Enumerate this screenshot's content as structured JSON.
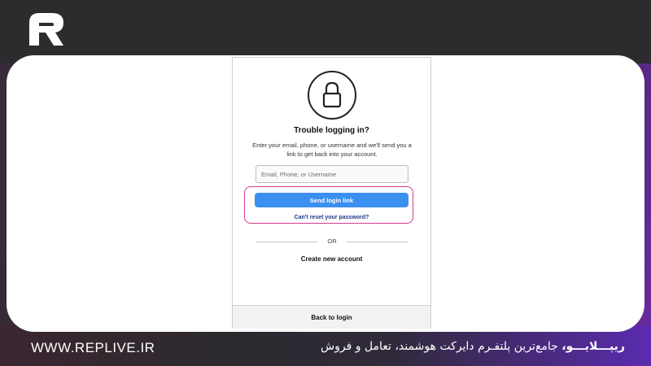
{
  "brand": {
    "logo_icon": "replive-logo-icon",
    "website": "WWW.REPLIVE.IR",
    "tagline_brand": "ریپـــلایـــو،",
    "tagline_rest": " جامع‌ترین پلتفـرم دایرکت هوشمند، تعامل و فروش"
  },
  "screen": {
    "icon": "lock-icon",
    "title": "Trouble logging in?",
    "description": "Enter your email, phone, or username and we'll send you a link to get back into your account.",
    "input_placeholder": "Email, Phone, or Username",
    "input_value": "",
    "send_button": "Send login link",
    "cant_reset": "Can't reset your password?",
    "or_divider": "OR",
    "create_account": "Create new account",
    "back_to_login": "Back to login"
  },
  "colors": {
    "primary_button": "#3b8ff0",
    "highlight_border": "#d63a8c",
    "link": "#1a3a8a"
  }
}
